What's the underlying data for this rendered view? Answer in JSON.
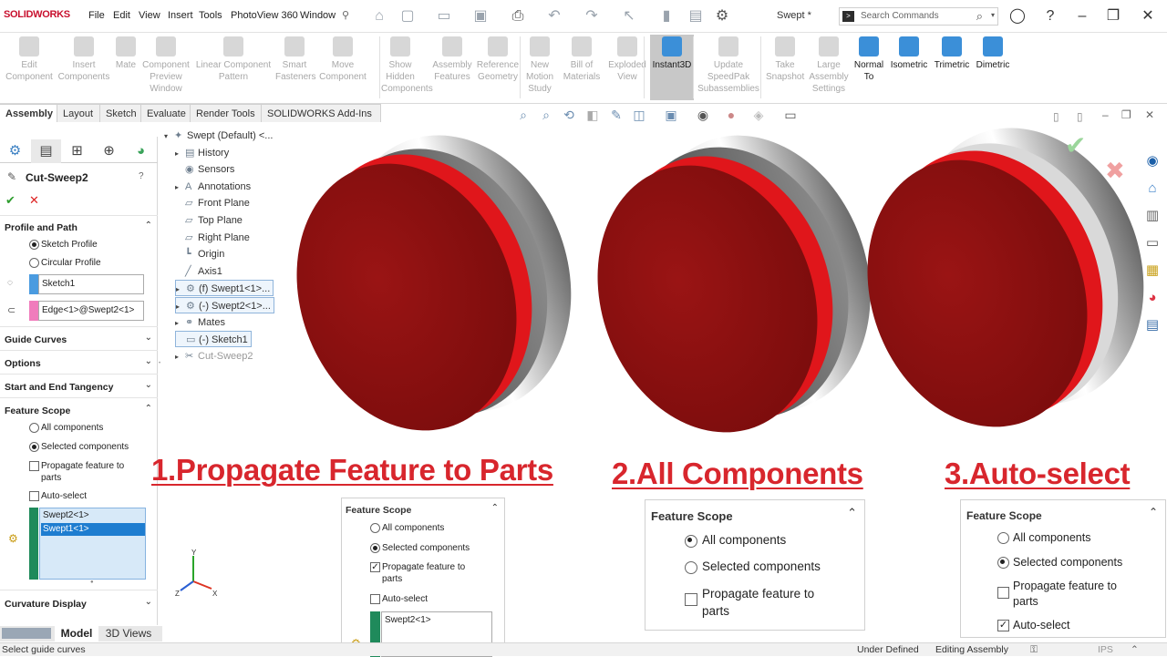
{
  "app": {
    "logo": "SOLIDWORKS",
    "doc_title": "Swept *",
    "search_placeholder": "Search Commands",
    "search_key": ">"
  },
  "menu": [
    "File",
    "Edit",
    "View",
    "Insert",
    "Tools",
    "PhotoView 360",
    "Window"
  ],
  "ribbon": [
    {
      "label": "Edit\nComponent",
      "enabled": false
    },
    {
      "label": "Insert\nComponents",
      "enabled": false
    },
    {
      "label": "Mate",
      "enabled": false
    },
    {
      "label": "Component\nPreview\nWindow",
      "enabled": false
    },
    {
      "label": "Linear Component\nPattern",
      "enabled": false
    },
    {
      "label": "Smart\nFasteners",
      "enabled": false
    },
    {
      "label": "Move\nComponent",
      "enabled": false
    },
    {
      "label": "Show\nHidden\nComponents",
      "enabled": false
    },
    {
      "label": "Assembly\nFeatures",
      "enabled": false
    },
    {
      "label": "Reference\nGeometry",
      "enabled": false
    },
    {
      "label": "New\nMotion\nStudy",
      "enabled": false
    },
    {
      "label": "Bill of\nMaterials",
      "enabled": false
    },
    {
      "label": "Exploded\nView",
      "enabled": false
    },
    {
      "label": "Instant3D",
      "enabled": true
    },
    {
      "label": "Update\nSpeedPak\nSubassemblies",
      "enabled": false
    },
    {
      "label": "Take\nSnapshot",
      "enabled": false
    },
    {
      "label": "Large\nAssembly\nSettings",
      "enabled": false
    },
    {
      "label": "Normal\nTo",
      "enabled": true
    },
    {
      "label": "Isometric",
      "enabled": true
    },
    {
      "label": "Trimetric",
      "enabled": true
    },
    {
      "label": "Dimetric",
      "enabled": true
    }
  ],
  "tabs": [
    "Assembly",
    "Layout",
    "Sketch",
    "Evaluate",
    "Render Tools",
    "SOLIDWORKS Add-Ins"
  ],
  "property_manager": {
    "title": "Cut-Sweep2",
    "help": "?",
    "sections": {
      "profile_path": "Profile and Path",
      "guide_curves": "Guide Curves",
      "options": "Options",
      "tangency": "Start and End Tangency",
      "feature_scope": "Feature Scope",
      "curvature": "Curvature Display"
    },
    "profile_options": [
      "Sketch Profile",
      "Circular Profile"
    ],
    "profile_field": "Sketch1",
    "path_field": "Edge<1>@Swept2<1>",
    "scope_options": [
      "All components",
      "Selected components"
    ],
    "propagate": "Propagate feature to parts",
    "auto_select": "Auto-select",
    "list_items": [
      "Swept2<1>",
      "Swept1<1>"
    ]
  },
  "tree": [
    {
      "label": "Swept (Default) <...",
      "arrow": "▾",
      "icon": "✦"
    },
    {
      "label": "History",
      "arrow": "▸",
      "icon": "▤"
    },
    {
      "label": "Sensors",
      "arrow": "",
      "icon": "◉"
    },
    {
      "label": "Annotations",
      "arrow": "▸",
      "icon": "A"
    },
    {
      "label": "Front Plane",
      "arrow": "",
      "icon": "▱"
    },
    {
      "label": "Top Plane",
      "arrow": "",
      "icon": "▱"
    },
    {
      "label": "Right Plane",
      "arrow": "",
      "icon": "▱"
    },
    {
      "label": "Origin",
      "arrow": "",
      "icon": "┗"
    },
    {
      "label": "Axis1",
      "arrow": "",
      "icon": "╱"
    },
    {
      "label": "(f) Swept1<1>...",
      "arrow": "▸",
      "icon": "⚙"
    },
    {
      "label": "(-) Swept2<1>...",
      "arrow": "▸",
      "icon": "⚙"
    },
    {
      "label": "Mates",
      "arrow": "▸",
      "icon": "⚭"
    },
    {
      "label": "(-) Sketch1",
      "arrow": "",
      "icon": "▭"
    },
    {
      "label": "Cut-Sweep2",
      "arrow": "▸",
      "icon": "✂"
    }
  ],
  "captions": [
    "1.Propagate Feature to Parts",
    "2.All Components",
    "3.Auto-select"
  ],
  "scope_panel_1": {
    "title": "Feature Scope",
    "opts": [
      "All components",
      "Selected components",
      "Propagate feature to parts",
      "Auto-select"
    ],
    "list_item": "Swept2<1>"
  },
  "scope_panel_2": {
    "title": "Feature Scope",
    "opts": [
      "All components",
      "Selected components",
      "Propagate feature to parts"
    ]
  },
  "scope_panel_3": {
    "title": "Feature Scope",
    "opts": [
      "All components",
      "Selected components",
      "Propagate feature to parts",
      "Auto-select"
    ]
  },
  "bottom_tabs": [
    "Model",
    "3D Views"
  ],
  "status": {
    "left": "Select guide curves",
    "defined": "Under Defined",
    "mode": "Editing Assembly",
    "units": "IPS"
  },
  "axes": {
    "y": "Y",
    "x": "X",
    "z": "Z"
  },
  "colors": {
    "disc_face": "#8e0f0f",
    "red_rim": "#e0161b",
    "brand": "#c8102e",
    "caption": "#d8262d"
  }
}
